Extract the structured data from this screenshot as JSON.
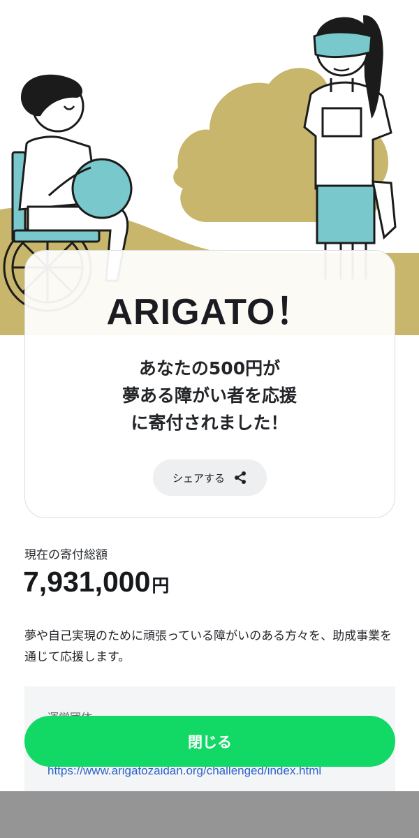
{
  "card": {
    "title": "ARIGATO！",
    "message_line1": "あなたの500円が",
    "message_line2": "夢ある障がい者を応援",
    "message_line3": "に寄付されました！",
    "share_label": "シェアする"
  },
  "donation": {
    "total_label": "現在の寄付総額",
    "total_amount": "7,931,000",
    "currency": "円"
  },
  "description": "夢や自己実現のために頑張っている障がいのある方々を、助成事業を通じて応援します。",
  "organization": {
    "label": "運営団体",
    "url": "https://www.arigatozaidan.org/challenged/index.html"
  },
  "close_label": "閉じる",
  "colors": {
    "accent_green": "#12d966",
    "illustration_olive": "#c7b66b",
    "illustration_teal": "#79c8cb",
    "link_blue": "#2a62c9"
  },
  "icons": [
    "share-icon"
  ]
}
